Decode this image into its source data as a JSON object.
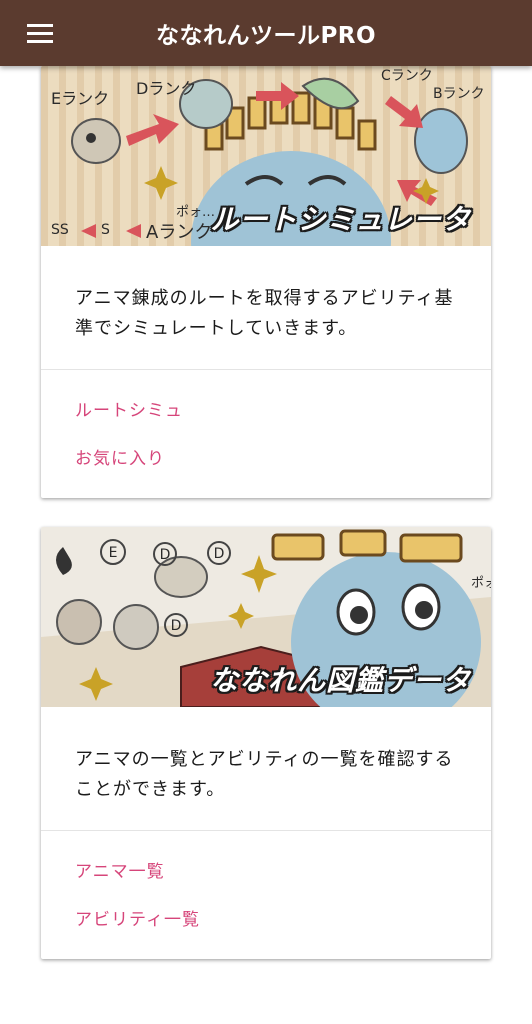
{
  "app": {
    "title": "ななれんツールPRO",
    "menu_icon": "hamburger-menu-icon"
  },
  "cards": [
    {
      "banner_title": "ルートシミュレータ",
      "banner_labels": {
        "e_rank": "Eランク",
        "d_rank": "Dランク",
        "c_rank": "Cランク",
        "b_rank": "Bランク",
        "a_rank": "Aランク",
        "ss": "SS",
        "s": "S",
        "sound": "ポォ…"
      },
      "description": "アニマ錬成のルートを取得するアビリティ基準でシミュレートしていきます。",
      "actions": [
        "ルートシミュ",
        "お気に入り"
      ]
    },
    {
      "banner_title": "ななれん図鑑データ",
      "banner_labels": {
        "e": "E",
        "d": "D",
        "sound": "ポォ…"
      },
      "description": "アニマの一覧とアビリティの一覧を確認することができます。",
      "actions": [
        "アニマ一覧",
        "アビリティ一覧"
      ]
    }
  ],
  "colors": {
    "appbar": "#5b3b2f",
    "link": "#d6457a",
    "banner_bg1": "#ecdcbf",
    "banner_bg2": "#eeeae2",
    "creature": "#9fc3d6"
  }
}
